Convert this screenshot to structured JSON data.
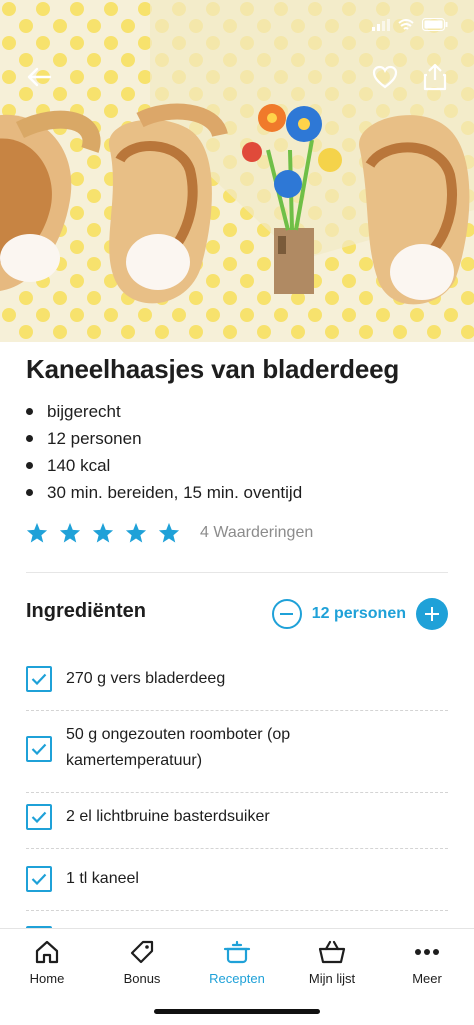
{
  "recipe": {
    "title": "Kaneelhaasjes van bladerdeeg",
    "meta": [
      "bijgerecht",
      "12 personen",
      "140 kcal",
      "30 min. bereiden, 15 min. oventijd"
    ],
    "rating_stars": 5,
    "rating_count": "4 Waarderingen"
  },
  "ingredients": {
    "title": "Ingrediënten",
    "servings": "12 personen",
    "items": [
      {
        "text": "270 g vers bladerdeeg",
        "checked": true
      },
      {
        "text": "50 g ongezouten roomboter (op kamertemperatuur)",
        "checked": true
      },
      {
        "text": "2 el lichtbruine basterdsuiker",
        "checked": true
      },
      {
        "text": "1 tl kaneel",
        "checked": true
      }
    ]
  },
  "tabs": [
    {
      "label": "Home",
      "icon": "home-icon",
      "active": false
    },
    {
      "label": "Bonus",
      "icon": "bonus-tag-icon",
      "active": false
    },
    {
      "label": "Recepten",
      "icon": "recipe-pot-icon",
      "active": true
    },
    {
      "label": "Mijn lijst",
      "icon": "basket-icon",
      "active": false
    },
    {
      "label": "Meer",
      "icon": "more-dots-icon",
      "active": false
    }
  ],
  "colors": {
    "accent": "#1fa1d8",
    "text": "#1e1e1e",
    "muted": "#8c8c8c"
  }
}
